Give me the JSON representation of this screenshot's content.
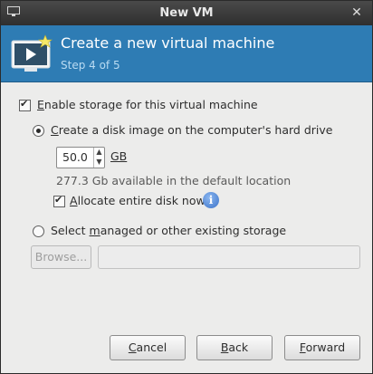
{
  "window": {
    "title": "New VM",
    "close_glyph": "✕"
  },
  "banner": {
    "heading": "Create a new virtual machine",
    "step": "Step 4 of 5"
  },
  "storage": {
    "enable_label_pre": "",
    "enable_label_u": "E",
    "enable_label_post": "nable storage for this virtual machine",
    "enable_checked": true,
    "create_disk_pre": "",
    "create_disk_u": "C",
    "create_disk_post": "reate a disk image on the computer's hard drive",
    "create_disk_selected": true,
    "size_value": "50.0",
    "size_unit": "GB",
    "available_text": "277.3 Gb available in the default location",
    "allocate_u": "A",
    "allocate_post": "llocate entire disk now",
    "allocate_checked": true,
    "managed_pre": "Select ",
    "managed_u": "m",
    "managed_post": "anaged or other existing storage",
    "managed_selected": false,
    "browse_label": "Browse...",
    "path_value": ""
  },
  "buttons": {
    "cancel_u": "C",
    "cancel_post": "ancel",
    "back_u": "B",
    "back_post": "ack",
    "forward_u": "F",
    "forward_post": "orward"
  },
  "icons": {
    "window_icon": "monitor-icon",
    "banner_icon": "virtual-machine-play-icon",
    "info": "info-icon",
    "spin_up": "spin-up-icon",
    "spin_down": "spin-down-icon"
  },
  "colors": {
    "banner": "#2e7cb4",
    "titlebar": "#3a3a3a"
  }
}
